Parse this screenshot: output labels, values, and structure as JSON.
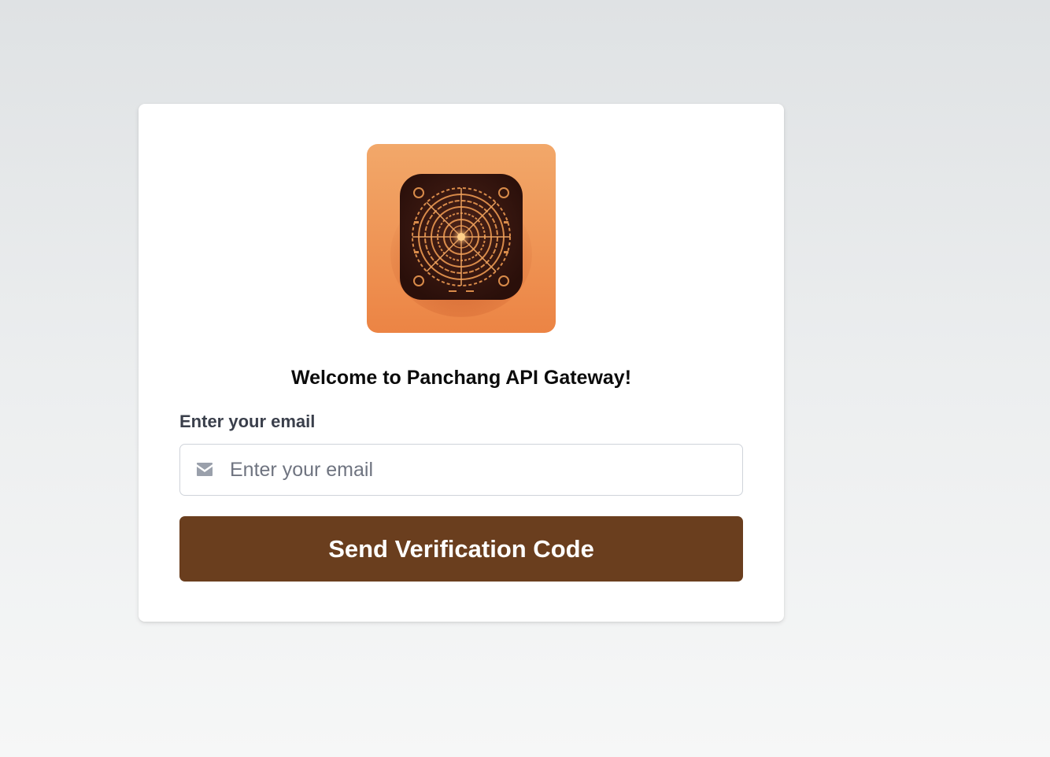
{
  "welcome": {
    "title": "Welcome to Panchang API Gateway!"
  },
  "form": {
    "email_label": "Enter your email",
    "email_placeholder": "Enter your email",
    "email_value": "",
    "email_icon": "mail-icon",
    "submit_label": "Send Verification Code"
  },
  "logo": {
    "icon": "panchang-app-logo",
    "background_color": "#f0a060",
    "tile_color": "#3a1a12",
    "ornament_color": "#d98b4a"
  },
  "colors": {
    "primary_button": "#6a3e1e",
    "button_text": "#ffffff",
    "label_text": "#3a3f4b",
    "placeholder_text": "#6f7480",
    "input_border": "#cfd3da"
  }
}
